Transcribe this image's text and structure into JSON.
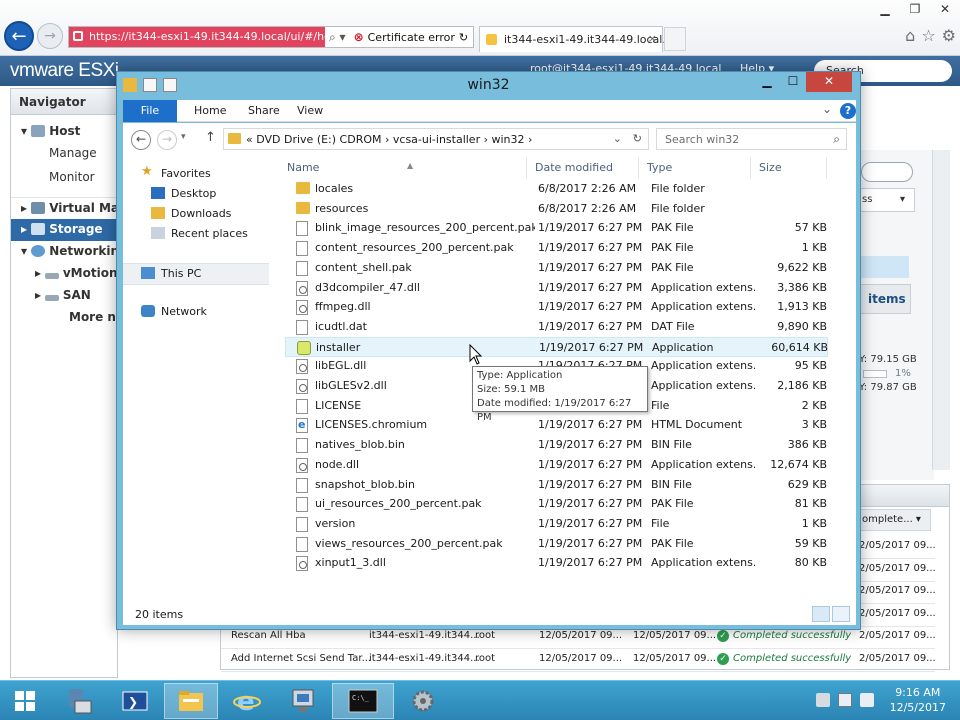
{
  "browser": {
    "address_url": "https://it344-esxi1-49.it344-49.local/ui/#/host/s",
    "cert_error": "Certificate error",
    "tab_title": "it344-esxi1-49.it344-49.local...",
    "tab_close": "×",
    "address_tools": "⌕ ▾"
  },
  "vsphere": {
    "logo": "vmware ESXi",
    "user": "root@it344-esxi1-49.it344-49.local",
    "help": "Help ▾",
    "search_placeholder": "Search",
    "navigator_title": "Navigator",
    "nav_items": [
      {
        "label": "Host",
        "level": 0,
        "kind": "header"
      },
      {
        "label": "Manage",
        "level": 1
      },
      {
        "label": "Monitor",
        "level": 1
      },
      {
        "label": "Virtual Mach",
        "level": 0,
        "kind": "header"
      },
      {
        "label": "Storage",
        "level": 0,
        "selected": true
      },
      {
        "label": "Networking",
        "level": 0,
        "kind": "header"
      },
      {
        "label": "vMotion",
        "level": 1
      },
      {
        "label": "SAN",
        "level": 1
      },
      {
        "label": "More ne",
        "level": 1
      }
    ],
    "right_panel": {
      "ss": "ss",
      "items": "items",
      "free": "Y: 79.15 GB",
      "pct": "1%",
      "total": "Y: 79.87 GB"
    },
    "tasks": {
      "col_complete": "omplete...",
      "rows": [
        {
          "task": "",
          "target": "",
          "user": "",
          "queued": "",
          "started": "",
          "result": "",
          "completed": "2/05/2017 09..."
        },
        {
          "task": "",
          "target": "",
          "user": "",
          "queued": "",
          "started": "",
          "result": "",
          "completed": "2/05/2017 09..."
        },
        {
          "task": "",
          "target": "",
          "user": "",
          "queued": "",
          "started": "",
          "result": "",
          "completed": "2/05/2017 09..."
        },
        {
          "task": "",
          "target": "",
          "user": "",
          "queued": "",
          "started": "",
          "result": "",
          "completed": "2/05/2017 09..."
        },
        {
          "task": "Rescan All Hba",
          "target": "it344-esxi1-49.it344...",
          "user": "root",
          "queued": "12/05/2017 09...",
          "started": "12/05/2017 09...",
          "result": "Completed successfully",
          "completed": "2/05/2017 09..."
        },
        {
          "task": "Add Internet Scsi Send Tar...",
          "target": "it344-esxi1-49.it344...",
          "user": "root",
          "queued": "12/05/2017 09...",
          "started": "12/05/2017 09...",
          "result": "Completed successfully",
          "completed": "2/05/2017 09..."
        }
      ]
    }
  },
  "explorer": {
    "title": "win32",
    "ribbon_tabs": [
      "File",
      "Home",
      "Share",
      "View"
    ],
    "breadcrumb": "«  DVD Drive (E:) CDROM  ›  vcsa-ui-installer  ›  win32  ›",
    "search_placeholder": "Search win32",
    "left_pane": {
      "favorites": "Favorites",
      "desktop": "Desktop",
      "downloads": "Downloads",
      "recent": "Recent places",
      "this_pc": "This PC",
      "network": "Network"
    },
    "columns": {
      "name": "Name",
      "date": "Date modified",
      "type": "Type",
      "size": "Size"
    },
    "files": [
      {
        "name": "locales",
        "date": "6/8/2017 2:26 AM",
        "type": "File folder",
        "size": "",
        "icon": "folder"
      },
      {
        "name": "resources",
        "date": "6/8/2017 2:26 AM",
        "type": "File folder",
        "size": "",
        "icon": "folder"
      },
      {
        "name": "blink_image_resources_200_percent.pak",
        "date": "1/19/2017 6:27 PM",
        "type": "PAK File",
        "size": "57 KB",
        "icon": "file"
      },
      {
        "name": "content_resources_200_percent.pak",
        "date": "1/19/2017 6:27 PM",
        "type": "PAK File",
        "size": "1 KB",
        "icon": "file"
      },
      {
        "name": "content_shell.pak",
        "date": "1/19/2017 6:27 PM",
        "type": "PAK File",
        "size": "9,622 KB",
        "icon": "file"
      },
      {
        "name": "d3dcompiler_47.dll",
        "date": "1/19/2017 6:27 PM",
        "type": "Application extens...",
        "size": "3,386 KB",
        "icon": "dll"
      },
      {
        "name": "ffmpeg.dll",
        "date": "1/19/2017 6:27 PM",
        "type": "Application extens...",
        "size": "1,913 KB",
        "icon": "dll"
      },
      {
        "name": "icudtl.dat",
        "date": "1/19/2017 6:27 PM",
        "type": "DAT File",
        "size": "9,890 KB",
        "icon": "file"
      },
      {
        "name": "installer",
        "date": "1/19/2017 6:27 PM",
        "type": "Application",
        "size": "60,614 KB",
        "icon": "app",
        "highlight": true
      },
      {
        "name": "libEGL.dll",
        "date": "1/19/2017 6:27 PM",
        "type": "Application extens...",
        "size": "95 KB",
        "icon": "dll"
      },
      {
        "name": "libGLESv2.dll",
        "date": "1/19/2017 6:27 PM",
        "type": "Application extens...",
        "size": "2,186 KB",
        "icon": "dll"
      },
      {
        "name": "LICENSE",
        "date": "1/19/2017 6:27 PM",
        "type": "File",
        "size": "2 KB",
        "icon": "file"
      },
      {
        "name": "LICENSES.chromium",
        "date": "1/19/2017 6:27 PM",
        "type": "HTML Document",
        "size": "3 KB",
        "icon": "html"
      },
      {
        "name": "natives_blob.bin",
        "date": "1/19/2017 6:27 PM",
        "type": "BIN File",
        "size": "386 KB",
        "icon": "file"
      },
      {
        "name": "node.dll",
        "date": "1/19/2017 6:27 PM",
        "type": "Application extens...",
        "size": "12,674 KB",
        "icon": "dll"
      },
      {
        "name": "snapshot_blob.bin",
        "date": "1/19/2017 6:27 PM",
        "type": "BIN File",
        "size": "629 KB",
        "icon": "file"
      },
      {
        "name": "ui_resources_200_percent.pak",
        "date": "1/19/2017 6:27 PM",
        "type": "PAK File",
        "size": "81 KB",
        "icon": "file"
      },
      {
        "name": "version",
        "date": "1/19/2017 6:27 PM",
        "type": "File",
        "size": "1 KB",
        "icon": "file"
      },
      {
        "name": "views_resources_200_percent.pak",
        "date": "1/19/2017 6:27 PM",
        "type": "PAK File",
        "size": "59 KB",
        "icon": "file"
      },
      {
        "name": "xinput1_3.dll",
        "date": "1/19/2017 6:27 PM",
        "type": "Application extens...",
        "size": "80 KB",
        "icon": "dll"
      }
    ],
    "tooltip": {
      "type": "Type: Application",
      "size": "Size: 59.1 MB",
      "date": "Date modified: 1/19/2017 6:27 PM"
    },
    "status_count": "20 items"
  },
  "taskbar": {
    "time": "9:16 AM",
    "date": "12/5/2017"
  },
  "colors": {
    "explorer_frame": "#78bedc",
    "vsphere_header": "#2d5987",
    "selection": "#e5f3fb",
    "taskbar": "#2b85b4"
  }
}
